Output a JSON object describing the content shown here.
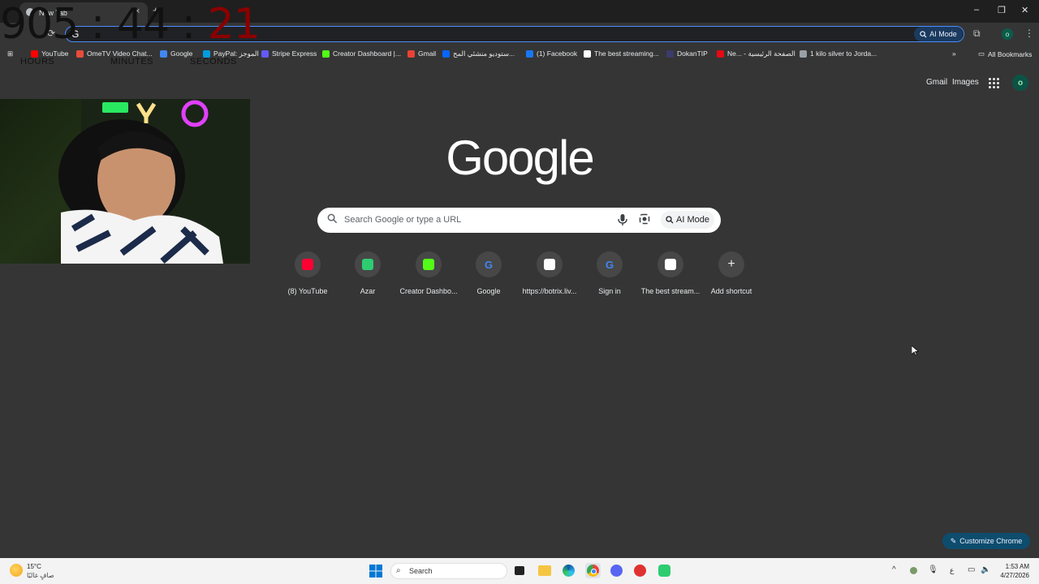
{
  "timer": {
    "hours": "905",
    "minutes": "44",
    "seconds": "21",
    "sep": ":",
    "label_hours": "HOURS",
    "label_minutes": "MINUTES",
    "label_seconds": "SECONDS"
  },
  "browser": {
    "tab_title": "New Tab",
    "tab_close": "×",
    "new_tab": "+",
    "omnibox_value": "G",
    "ai_mode_label": "AI Mode",
    "window": {
      "minimize": "–",
      "maximize": "❐",
      "close": "✕"
    },
    "profile_initial": "o",
    "bookmarks": [
      {
        "label": "YouTube",
        "color": "#ff0000"
      },
      {
        "label": "OmeTV Video Chat...",
        "color": "#e74c3c"
      },
      {
        "label": "Google",
        "color": "#4285f4"
      },
      {
        "label": "PayPal: الموجز",
        "color": "#009cde"
      },
      {
        "label": "Stripe Express",
        "color": "#635bff"
      },
      {
        "label": "Creator Dashboard |...",
        "color": "#53fc18"
      },
      {
        "label": "Gmail",
        "color": "#ea4335"
      },
      {
        "label": "ستوديو منشئي المح...",
        "color": "#0866ff"
      },
      {
        "label": "(1) Facebook",
        "color": "#1877f2"
      },
      {
        "label": "The best streaming...",
        "color": "#ffffff"
      },
      {
        "label": "DokanTIP",
        "color": "#3b3b6d"
      },
      {
        "label": "Ne... - الصفحة الرئيسية",
        "color": "#e50914"
      },
      {
        "label": "1 kilo silver to Jorda...",
        "color": "#9aa0a6"
      }
    ],
    "more_bookmarks": "»",
    "all_bookmarks": "All Bookmarks"
  },
  "ntp": {
    "gmail": "Gmail",
    "images": "Images",
    "avatar_initial": "o",
    "logo": "Google",
    "search_placeholder": "Search Google or type a URL",
    "ai_mode_label": "AI Mode",
    "shortcuts": [
      {
        "label": "(8) YouTube",
        "icon": "youtube-icon",
        "color": "#ff0033"
      },
      {
        "label": "Azar",
        "icon": "azar-icon",
        "color": "#2ecc71"
      },
      {
        "label": "Creator Dashbo...",
        "icon": "kick-icon",
        "color": "#53fc18"
      },
      {
        "label": "Google",
        "icon": "google-icon",
        "color": "#4285f4"
      },
      {
        "label": "https://botrix.liv...",
        "icon": "botrix-icon",
        "color": "#ffffff"
      },
      {
        "label": "Sign in",
        "icon": "google-icon",
        "color": "#4285f4"
      },
      {
        "label": "The best stream...",
        "icon": "botrix-icon",
        "color": "#ffffff"
      },
      {
        "label": "Add shortcut",
        "icon": "plus-icon",
        "color": "#e8eaed"
      }
    ],
    "customize": "Customize Chrome"
  },
  "taskbar": {
    "temp": "15°C",
    "weather": "صافٍ غالبًا",
    "search": "Search",
    "lang": "ع",
    "time": "1:53 AM",
    "date": "4/27/2026"
  }
}
